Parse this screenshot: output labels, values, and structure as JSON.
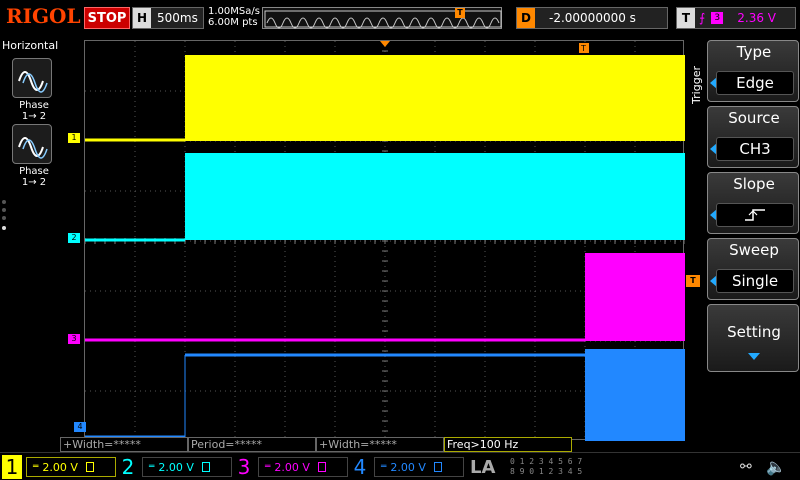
{
  "brand": "RIGOL",
  "run_state": "STOP",
  "horizontal": {
    "label": "H",
    "timebase": "500ms",
    "sample_rate": "1.00MSa/s",
    "mem_depth": "6.00M pts"
  },
  "delay": {
    "label": "D",
    "value": "-2.00000000 s"
  },
  "trigger_status": {
    "label": "T",
    "source_num": "3",
    "level": "2.36 V"
  },
  "left_panel": {
    "title": "Horizontal",
    "buttons": [
      {
        "label": "Phase",
        "sub": "1→ 2",
        "icon": "sine-wave-icon"
      },
      {
        "label": "Phase",
        "sub": "1→ 2",
        "icon": "sine-wave-icon"
      }
    ]
  },
  "trigger_menu": {
    "section_label": "Trigger",
    "items": [
      {
        "title": "Type",
        "value": "Edge"
      },
      {
        "title": "Source",
        "value": "CH3"
      },
      {
        "title": "Slope",
        "value": ""
      },
      {
        "title": "Sweep",
        "value": "Single"
      }
    ],
    "setting_label": "Setting"
  },
  "measurements": [
    {
      "text": "+Width=*****"
    },
    {
      "text": "Period=*****"
    },
    {
      "text": "+Width=*****"
    },
    {
      "text": "Freq>100 Hz"
    }
  ],
  "channels": [
    {
      "num": "1",
      "scale": "2.00 V",
      "color": "#ffff00",
      "marker": "1"
    },
    {
      "num": "2",
      "scale": "2.00 V",
      "color": "#00ffff",
      "marker": "2"
    },
    {
      "num": "3",
      "scale": "2.00 V",
      "color": "#ff00ff",
      "marker": "3"
    },
    {
      "num": "4",
      "scale": "2.00 V",
      "color": "#2288ff",
      "marker": "4"
    }
  ],
  "la_label": "LA",
  "la_bits": [
    "0 1 2 3  4 5 6 7",
    "8 9 0 1  2 3 4 5"
  ],
  "markers": {
    "trigger": "T"
  },
  "colors": {
    "trigger_marker": "#ff8800",
    "ch1": "#ffff00",
    "ch2": "#00ffff",
    "ch3": "#ff00ff",
    "ch4": "#2288ff"
  }
}
